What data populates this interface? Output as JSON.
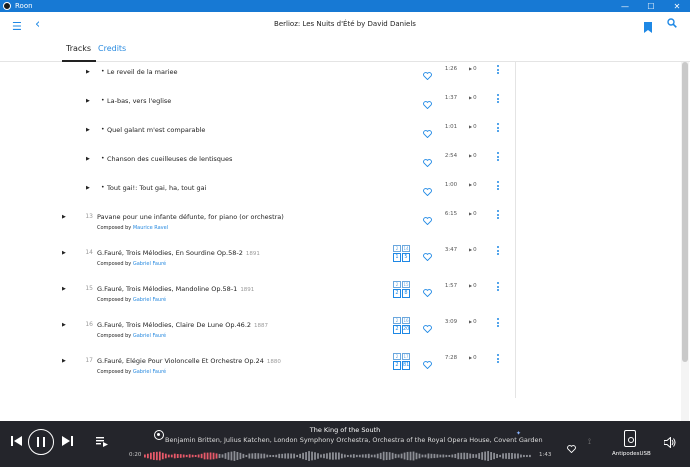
{
  "window": {
    "title": "Roon",
    "controls": {
      "minimize": "—",
      "maximize": "☐",
      "close": "✕"
    }
  },
  "header": {
    "album_title": "Berlioz: Les Nuits d'Été by David Daniels"
  },
  "tabs": [
    {
      "label": "Tracks",
      "active": true
    },
    {
      "label": "Credits",
      "active": false
    }
  ],
  "tracks": [
    {
      "sub": true,
      "title": "Le reveil de la mariee",
      "duration": "1:26",
      "plays": "0"
    },
    {
      "sub": true,
      "title": "La-bas, vers l'eglise",
      "duration": "1:37",
      "plays": "0"
    },
    {
      "sub": true,
      "title": "Quel galant m'est comparable",
      "duration": "1:01",
      "plays": "0"
    },
    {
      "sub": true,
      "title": "Chanson des cueilleuses de lentisques",
      "duration": "2:54",
      "plays": "0"
    },
    {
      "sub": true,
      "title": "Tout gai!: Tout gai, ha, tout gai",
      "duration": "1:00",
      "plays": "0"
    },
    {
      "sub": false,
      "number": "13",
      "title": "Pavane pour une infante défunte, for piano (or orchestra)",
      "year": "",
      "composed_by_label": "Composed by",
      "composer": "Maurice Ravel",
      "duration": "6:15",
      "plays": "0"
    },
    {
      "sub": false,
      "number": "14",
      "title": "G.Fauré, Trois Mélodies, En Sourdine Op.58-2",
      "year": "1891",
      "composed_by_label": "Composed by",
      "composer": "Gabriel Fauré",
      "duration": "3:47",
      "plays": "0",
      "disc": {
        "top": [
          "2",
          "14"
        ],
        "bottom": [
          "1",
          "5"
        ]
      }
    },
    {
      "sub": false,
      "number": "15",
      "title": "G.Fauré, Trois Mélodies, Mandoline Op.58-1",
      "year": "1891",
      "composed_by_label": "Composed by",
      "composer": "Gabriel Fauré",
      "duration": "1:57",
      "plays": "0",
      "disc": {
        "top": [
          "2",
          "15"
        ],
        "bottom": [
          "2",
          "8"
        ]
      }
    },
    {
      "sub": false,
      "number": "16",
      "title": "G.Fauré, Trois Mélodies, Claire De Lune Op.46.2",
      "year": "1887",
      "composed_by_label": "Composed by",
      "composer": "Gabriel Fauré",
      "duration": "3:09",
      "plays": "0",
      "disc": {
        "top": [
          "2",
          "16"
        ],
        "bottom": [
          "2",
          "20"
        ]
      }
    },
    {
      "sub": false,
      "number": "17",
      "title": "G.Fauré, Elégie Pour Violoncelle Et Orchestre Op.24",
      "year": "1880",
      "composed_by_label": "Composed by",
      "composer": "Gabriel Fauré",
      "duration": "7:28",
      "plays": "0",
      "disc": {
        "top": [
          "2",
          "17"
        ],
        "bottom": [
          "2",
          "81"
        ]
      }
    }
  ],
  "player": {
    "title": "The King of the South",
    "artists": "Benjamin Britten, Julius Katchen, London Symphony Orchestra, Orchestra of the Royal Opera House, Covent Garden",
    "elapsed": "0:20",
    "total": "1:43",
    "progress": 0.19,
    "zone": "AntipodesUSB"
  },
  "colors": {
    "accent": "#1e88e5",
    "titlebar": "#1779d4",
    "player_bg": "#24252b"
  },
  "icons": {
    "menu": "hamburger-icon",
    "back": "chevron-left-icon",
    "bookmark": "bookmark-icon",
    "search": "search-icon",
    "play": "play-triangle-icon",
    "heart": "heart-icon",
    "more": "vertical-dots-icon",
    "prev": "skip-previous-icon",
    "pause": "pause-icon",
    "next": "skip-next-icon",
    "queue": "queue-icon",
    "volume": "volume-icon",
    "zone": "speaker-icon",
    "radio": "radio-icon"
  }
}
